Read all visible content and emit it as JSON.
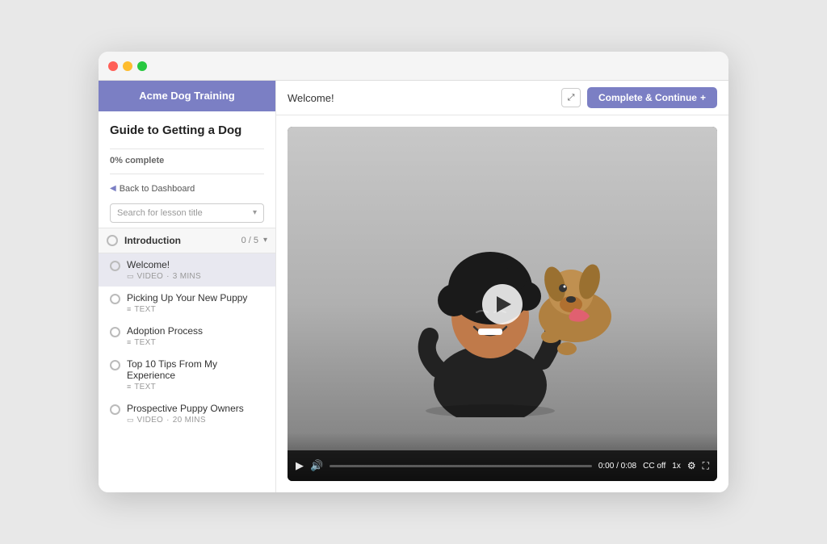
{
  "window": {
    "title": "Acme Dog Training"
  },
  "sidebar": {
    "header_title": "Acme Dog Training",
    "course_title": "Guide to Getting a Dog",
    "progress_text": "0% complete",
    "back_label": "Back to Dashboard",
    "search_placeholder": "Search for lesson title",
    "section": {
      "title": "Introduction",
      "count": "0 / 5"
    },
    "lessons": [
      {
        "name": "Welcome!",
        "type": "VIDEO",
        "duration": "3 MINS",
        "active": true
      },
      {
        "name": "Picking Up Your New Puppy",
        "type": "TEXT",
        "duration": "",
        "active": false
      },
      {
        "name": "Adoption Process",
        "type": "TEXT",
        "duration": "",
        "active": false
      },
      {
        "name": "Top 10 Tips From My Experience",
        "type": "TEXT",
        "duration": "",
        "active": false
      },
      {
        "name": "Prospective Puppy Owners",
        "type": "VIDEO",
        "duration": "20 MINS",
        "active": false
      }
    ]
  },
  "main": {
    "lesson_title": "Welcome!",
    "complete_button": "Complete & Continue",
    "complete_button_icon": "+",
    "expand_icon": "⤢",
    "video": {
      "time_current": "0:00",
      "time_total": "0:08",
      "cc_label": "CC off",
      "speed_label": "1x"
    }
  }
}
